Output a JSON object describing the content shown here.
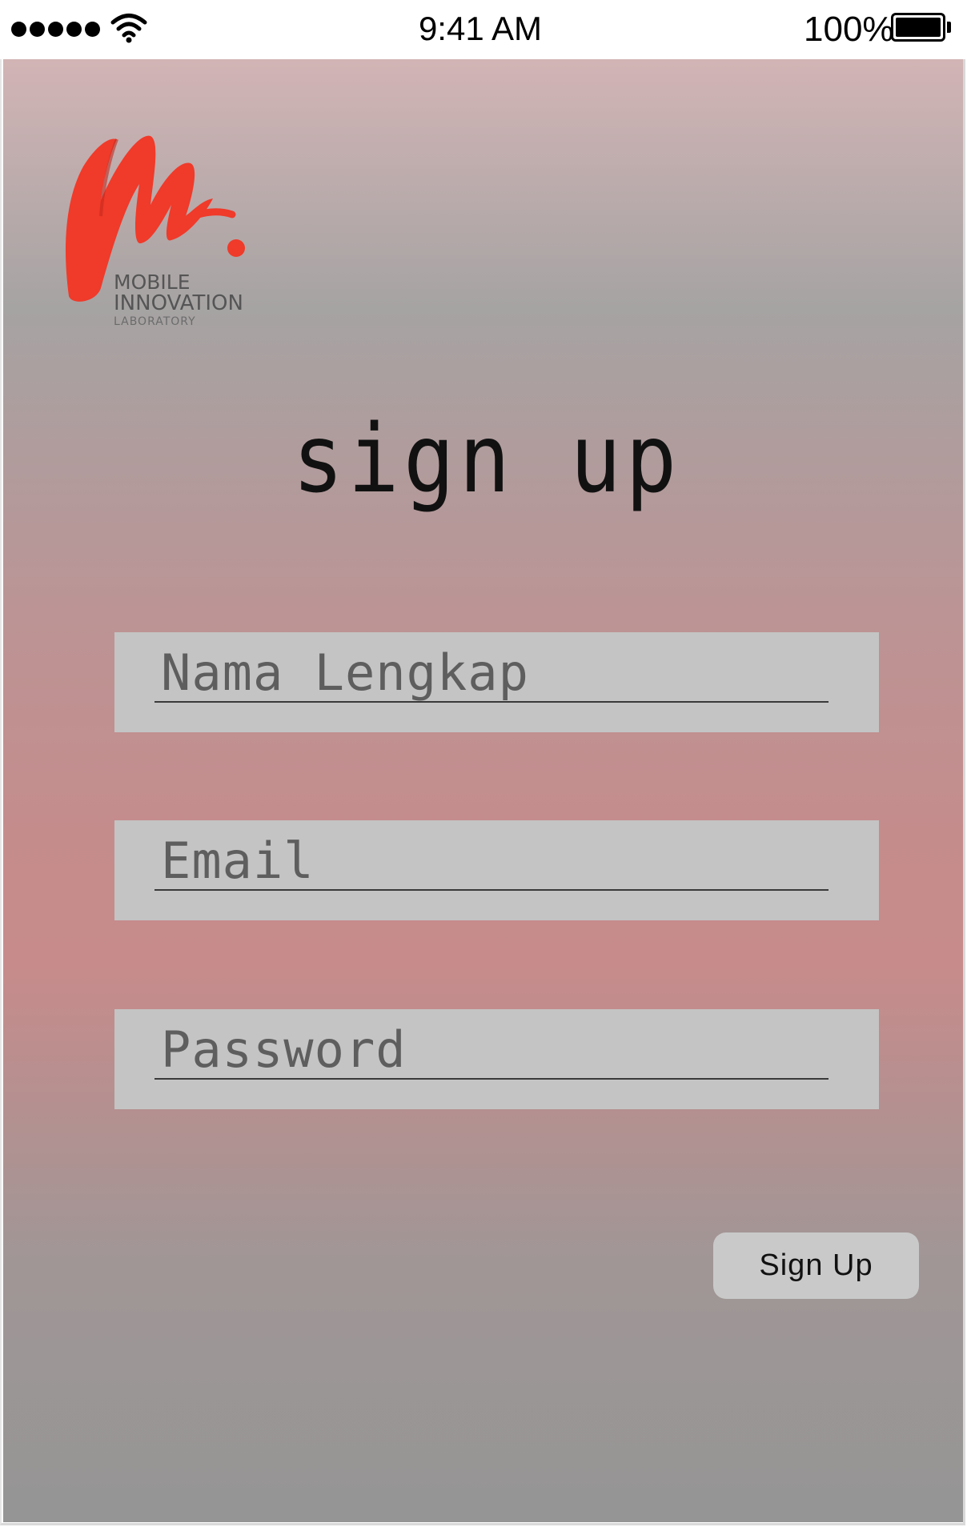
{
  "status_bar": {
    "time": "9:41 AM",
    "battery_percent": "100%",
    "signal_icon": "signal-dots-icon",
    "wifi_icon": "wifi-icon",
    "battery_icon": "battery-icon"
  },
  "logo": {
    "line1": "MOBILE",
    "line2": "INNOVATION",
    "line3": "LABORATORY",
    "mark_color": "#f03a2a"
  },
  "title": "sign up",
  "form": {
    "full_name": {
      "placeholder": "Nama Lengkap",
      "value": ""
    },
    "email": {
      "placeholder": "Email",
      "value": ""
    },
    "password": {
      "placeholder": "Password",
      "value": ""
    }
  },
  "buttons": {
    "sign_up": "Sign Up"
  },
  "colors": {
    "field_bg": "#c4c4c4",
    "button_bg": "#c9c9c9",
    "gradient_top": "#d2b4b5",
    "gradient_mid": "#c78b8b",
    "gradient_bottom": "#959595"
  }
}
